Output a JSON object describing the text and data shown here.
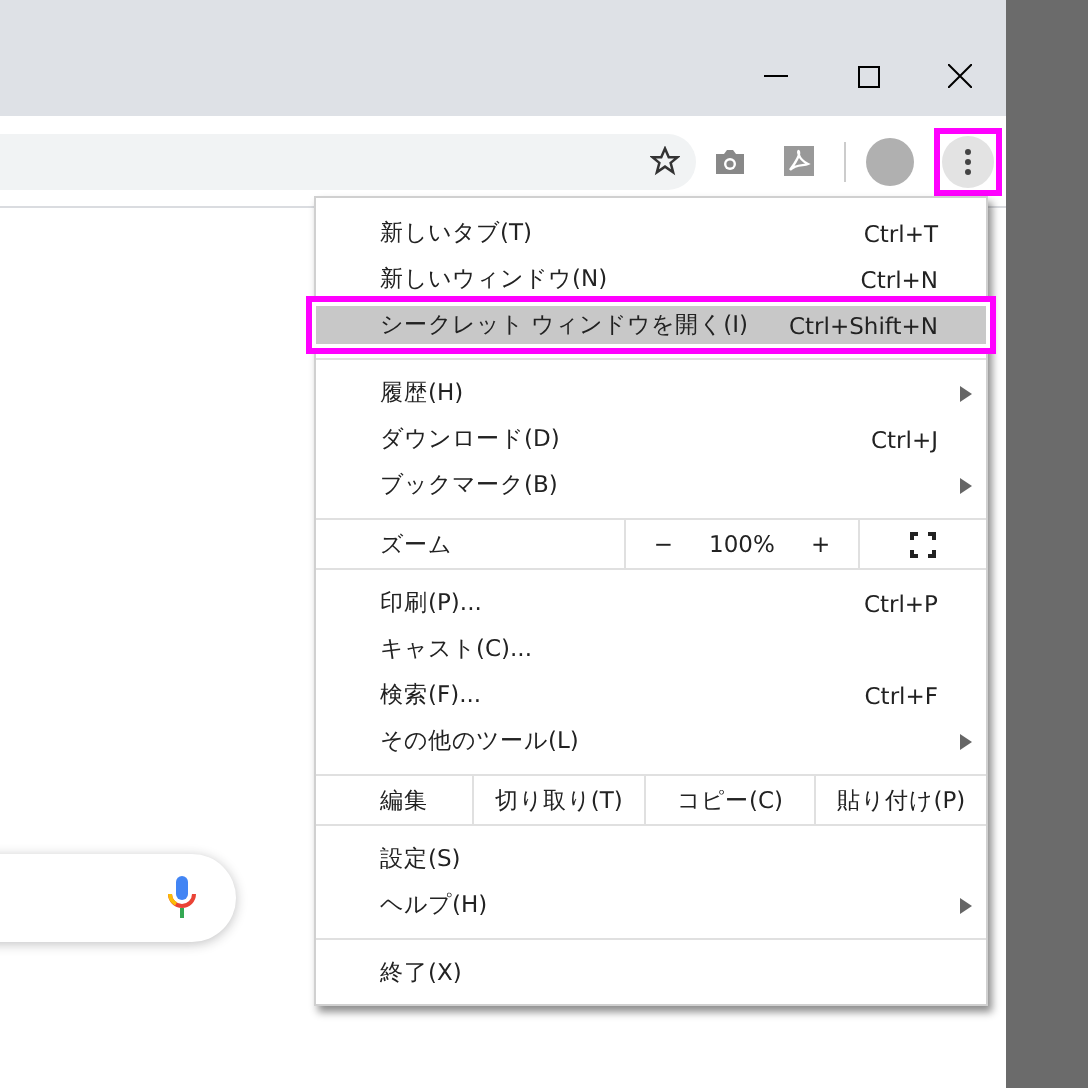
{
  "toolbar": {
    "menu_button": {
      "outlined": true
    }
  },
  "menu": {
    "sections": [
      [
        {
          "kind": "item",
          "label": "新しいタブ(T)",
          "shortcut": "Ctrl+T",
          "submenu": false,
          "selected": false,
          "outlined": false
        },
        {
          "kind": "item",
          "label": "新しいウィンドウ(N)",
          "shortcut": "Ctrl+N",
          "submenu": false,
          "selected": false,
          "outlined": false
        },
        {
          "kind": "item",
          "label": "シークレット ウィンドウを開く(I)",
          "shortcut": "Ctrl+Shift+N",
          "submenu": false,
          "selected": true,
          "outlined": true
        }
      ],
      [
        {
          "kind": "item",
          "label": "履歴(H)",
          "submenu": true,
          "selected": false,
          "outlined": false
        },
        {
          "kind": "item",
          "label": "ダウンロード(D)",
          "shortcut": "Ctrl+J",
          "submenu": false,
          "selected": false,
          "outlined": false
        },
        {
          "kind": "item",
          "label": "ブックマーク(B)",
          "submenu": true,
          "selected": false,
          "outlined": false
        }
      ],
      [
        {
          "kind": "zoom",
          "label": "ズーム",
          "minus": "−",
          "value": "100%",
          "plus": "+"
        }
      ],
      [
        {
          "kind": "item",
          "label": "印刷(P)...",
          "shortcut": "Ctrl+P",
          "submenu": false,
          "selected": false,
          "outlined": false
        },
        {
          "kind": "item",
          "label": "キャスト(C)...",
          "submenu": false,
          "selected": false,
          "outlined": false
        },
        {
          "kind": "item",
          "label": "検索(F)...",
          "shortcut": "Ctrl+F",
          "submenu": false,
          "selected": false,
          "outlined": false
        },
        {
          "kind": "item",
          "label": "その他のツール(L)",
          "submenu": true,
          "selected": false,
          "outlined": false
        }
      ],
      [
        {
          "kind": "edit",
          "label": "編集",
          "actions": [
            "切り取り(T)",
            "コピー(C)",
            "貼り付け(P)"
          ]
        }
      ],
      [
        {
          "kind": "item",
          "label": "設定(S)",
          "submenu": false,
          "selected": false,
          "outlined": false
        },
        {
          "kind": "item",
          "label": "ヘルプ(H)",
          "submenu": true,
          "selected": false,
          "outlined": false
        }
      ],
      [
        {
          "kind": "item",
          "label": "終了(X)",
          "submenu": false,
          "selected": false,
          "outlined": false
        }
      ]
    ]
  }
}
